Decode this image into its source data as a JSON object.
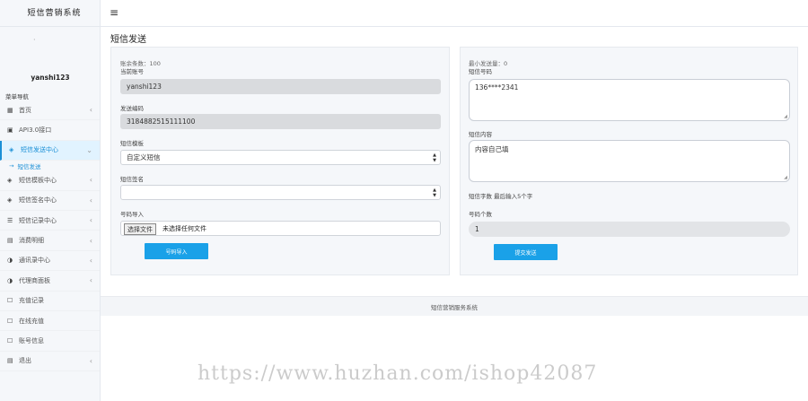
{
  "app": {
    "title": "短信营销系统"
  },
  "user": {
    "name": "yanshi123"
  },
  "sidebar": {
    "menu_title": "菜单导航",
    "items": [
      {
        "icon": "▦",
        "label": "首页"
      },
      {
        "icon": "▣",
        "label": "API3.0接口"
      },
      {
        "icon": "◈",
        "label": "短信发送中心",
        "sub": "短信发送"
      },
      {
        "icon": "◈",
        "label": "短信模板中心"
      },
      {
        "icon": "◈",
        "label": "短信签名中心"
      },
      {
        "icon": "☰",
        "label": "短信记录中心"
      },
      {
        "icon": "▤",
        "label": "消费明细"
      },
      {
        "icon": "◑",
        "label": "通讯录中心"
      },
      {
        "icon": "◑",
        "label": "代理商面板"
      },
      {
        "icon": "☐",
        "label": "充值记录"
      },
      {
        "icon": "☐",
        "label": "在线充值"
      },
      {
        "icon": "☐",
        "label": "账号信息"
      },
      {
        "icon": "▤",
        "label": "退出"
      }
    ]
  },
  "page": {
    "title": "短信发送"
  },
  "left_panel": {
    "remaining": "账余条数：100",
    "account_label": "当前账号",
    "account_value": "yanshi123",
    "code_label": "发送编码",
    "code_value": "3184882515111100",
    "type_label": "短信模板",
    "type_value": "自定义短信",
    "sign_label": "短信签名",
    "sign_value": "",
    "import_label": "号码导入",
    "file_button": "选择文件",
    "file_none": "未选择任何文件",
    "import_button": "号码导入"
  },
  "right_panel": {
    "min_send": "最小发送量：0",
    "phone_label": "短信号码",
    "phone_value": "136****2341",
    "content_label": "短信内容",
    "content_value": "内容自己填",
    "count_text": "短信字数 最后输入5个字",
    "num_label": "号码个数",
    "num_value": "1",
    "send_button": "提交发送"
  },
  "footer": {
    "text": "短信营销服务系统"
  },
  "watermark": {
    "text": "https://www.huzhan.com/ishop42087"
  },
  "colors": {
    "accent": "#1aa1e8",
    "active_bg": "#e1f3ff"
  }
}
